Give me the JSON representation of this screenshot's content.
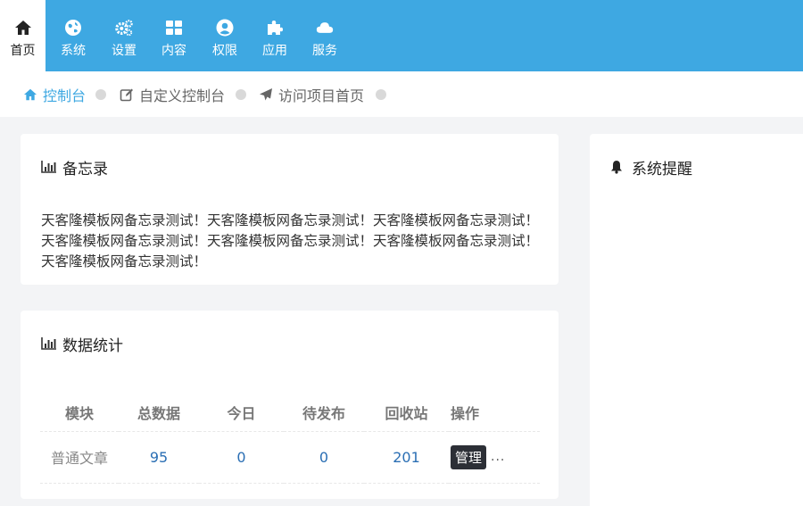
{
  "nav": {
    "items": [
      {
        "label": "首页",
        "icon": "home-icon"
      },
      {
        "label": "系统",
        "icon": "globe-icon"
      },
      {
        "label": "设置",
        "icon": "gears-icon"
      },
      {
        "label": "内容",
        "icon": "grid-icon"
      },
      {
        "label": "权限",
        "icon": "user-circle-icon"
      },
      {
        "label": "应用",
        "icon": "puzzle-icon"
      },
      {
        "label": "服务",
        "icon": "cloud-icon"
      }
    ],
    "active_index": 0,
    "bg_color": "#3ea8e2"
  },
  "breadcrumb": [
    {
      "label": "控制台",
      "icon": "home-icon"
    },
    {
      "label": "自定义控制台",
      "icon": "edit-icon"
    },
    {
      "label": "访问项目首页",
      "icon": "paper-plane-icon"
    }
  ],
  "memo": {
    "title": "备忘录",
    "icon": "bar-chart-icon",
    "text": "天客隆模板网备忘录测试！天客隆模板网备忘录测试！天客隆模板网备忘录测试！天客隆模板网备忘录测试！天客隆模板网备忘录测试！天客隆模板网备忘录测试！天客隆模板网备忘录测试！"
  },
  "stats": {
    "title": "数据统计",
    "icon": "bar-chart-icon",
    "headers": [
      "模块",
      "总数据",
      "今日",
      "待发布",
      "回收站",
      "操作"
    ],
    "rows": [
      {
        "module": "普通文章",
        "total": "95",
        "today": "0",
        "pending": "0",
        "recycle": "201",
        "action": "管理",
        "more": "..."
      }
    ]
  },
  "reminder": {
    "title": "系统提醒",
    "icon": "bell-icon"
  }
}
